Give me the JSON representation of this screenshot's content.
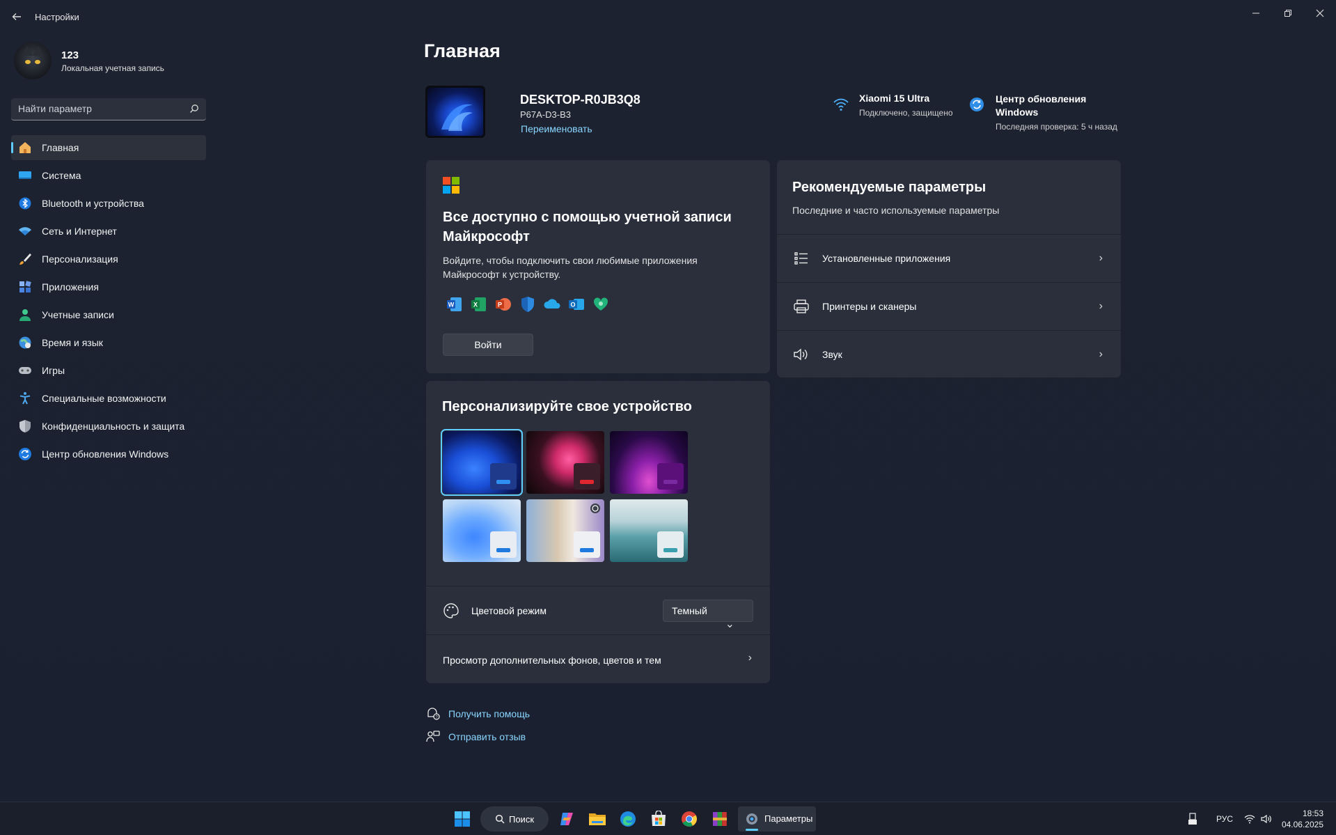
{
  "window": {
    "title": "Настройки",
    "back_icon": "back-arrow-icon",
    "controls": [
      "minimize-icon",
      "restore-icon",
      "close-icon"
    ]
  },
  "profile": {
    "name": "123",
    "account_type": "Локальная учетная запись"
  },
  "search": {
    "placeholder": "Найти параметр",
    "icon": "search-icon"
  },
  "nav": {
    "items": [
      {
        "label": "Главная",
        "icon": "home-icon",
        "active": true
      },
      {
        "label": "Система",
        "icon": "system-icon"
      },
      {
        "label": "Bluetooth и устройства",
        "icon": "bluetooth-icon"
      },
      {
        "label": "Сеть и Интернет",
        "icon": "network-icon"
      },
      {
        "label": "Персонализация",
        "icon": "brush-icon"
      },
      {
        "label": "Приложения",
        "icon": "apps-icon"
      },
      {
        "label": "Учетные записи",
        "icon": "accounts-icon"
      },
      {
        "label": "Время и язык",
        "icon": "time-language-icon"
      },
      {
        "label": "Игры",
        "icon": "gamepad-icon"
      },
      {
        "label": "Специальные возможности",
        "icon": "accessibility-icon"
      },
      {
        "label": "Конфиденциальность и защита",
        "icon": "shield-icon"
      },
      {
        "label": "Центр обновления Windows",
        "icon": "update-icon"
      }
    ]
  },
  "main": {
    "title": "Главная",
    "device": {
      "name": "DESKTOP-R0JB3Q8",
      "model": "P67A-D3-B3",
      "rename": "Переименовать"
    },
    "wifi": {
      "name": "Xiaomi 15 Ultra",
      "status": "Подключено, защищено"
    },
    "update": {
      "name": "Центр обновления Windows",
      "status": "Последняя проверка: 5 ч назад"
    },
    "ms_card": {
      "title": "Все доступно с помощью учетной записи Майкрософт",
      "description": "Войдите, чтобы подключить свои любимые приложения Майкрософт к устройству.",
      "apps": [
        "word-icon",
        "excel-icon",
        "powerpoint-icon",
        "defender-icon",
        "onedrive-icon",
        "outlook-icon",
        "family-icon"
      ],
      "signin": "Войти"
    },
    "recommended": {
      "title": "Рекомендуемые параметры",
      "subtitle": "Последние и часто используемые параметры",
      "items": [
        {
          "label": "Установленные приложения",
          "icon": "list-icon"
        },
        {
          "label": "Принтеры и сканеры",
          "icon": "printer-icon"
        },
        {
          "label": "Звук",
          "icon": "speaker-icon"
        }
      ]
    },
    "personalize": {
      "title": "Персонализируйте свое устройство",
      "themes": [
        {
          "name": "theme-bloom-dark",
          "selected": true
        },
        {
          "name": "theme-flower"
        },
        {
          "name": "theme-glow"
        },
        {
          "name": "theme-bloom-light"
        },
        {
          "name": "theme-spotlight"
        },
        {
          "name": "theme-lake"
        }
      ],
      "color_mode_label": "Цветовой режим",
      "color_mode_value": "Темный",
      "more_link": "Просмотр дополнительных фонов, цветов и тем"
    },
    "help": {
      "get_help": "Получить помощь",
      "feedback": "Отправить отзыв"
    }
  },
  "taskbar": {
    "search_label": "Поиск",
    "active_app": "Параметры",
    "language": "РУС",
    "time": "18:53",
    "date": "04.06.2025"
  },
  "colors": {
    "accent": "#60cdff",
    "card": "#2a2f3b",
    "background": "#1d2230"
  }
}
